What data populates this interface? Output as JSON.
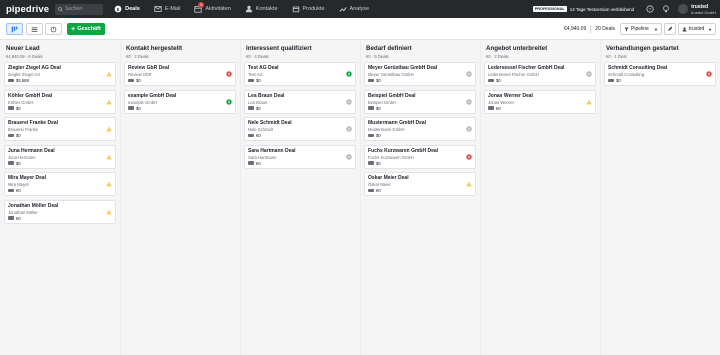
{
  "app": {
    "logo": "pipedrive",
    "search_placeholder": "Suchen"
  },
  "nav": [
    {
      "label": "Deals",
      "icon": "dollar-icon",
      "active": true
    },
    {
      "label": "E-Mail",
      "icon": "mail-icon"
    },
    {
      "label": "Aktivitäten",
      "icon": "calendar-icon",
      "badge": "5"
    },
    {
      "label": "Kontakte",
      "icon": "person-icon"
    },
    {
      "label": "Produkte",
      "icon": "box-icon"
    },
    {
      "label": "Analyse",
      "icon": "chart-icon"
    }
  ],
  "topright": {
    "plan": "PROFESSIONAL",
    "trial": "14 Tage Testversion verbleibend",
    "user": "trusted",
    "company": "trusted GmbH"
  },
  "toolbar": {
    "add_label": "Geschäft",
    "total": "€4,940.09",
    "deals_count": "20 Deals",
    "pipeline_label": "Pipeline",
    "owner_label": "trusted"
  },
  "colors": {
    "green": "#08a742",
    "warn": "#f6c344",
    "red": "#e0483f",
    "grey": "#b2b5ba"
  },
  "columns": [
    {
      "title": "Neuer Lead",
      "sub": "€4,940.09 · 6 Deals",
      "cards": [
        {
          "title": "Ziegler Ziegel AG Deal",
          "org": "Ziegler Ziegel AG",
          "value": "$5,588",
          "status": "warn"
        },
        {
          "title": "Köhler GmbH Deal",
          "org": "Köhler GmbH",
          "value": "$0",
          "status": "warn"
        },
        {
          "title": "Brauerei Franke Deal",
          "org": "Brauerei Franke",
          "value": "$0",
          "status": "warn"
        },
        {
          "title": "Juna Hermann Deal",
          "org": "Juna Hermann",
          "value": "$0",
          "status": "warn"
        },
        {
          "title": "Mira Mayer Deal",
          "org": "Mira Mayer",
          "value": "€0",
          "status": "warn"
        },
        {
          "title": "Jonathan Möller Deal",
          "org": "Jonathan Möller",
          "value": "€0",
          "status": "warn"
        }
      ]
    },
    {
      "title": "Kontakt hergestellt",
      "sub": "€0 · 2 Deals",
      "cards": [
        {
          "title": "Review GbR Deal",
          "org": "Review GbR",
          "value": "$0",
          "status": "red"
        },
        {
          "title": "example GmbH Deal",
          "org": "example GmbH",
          "value": "$0",
          "status": "green"
        }
      ]
    },
    {
      "title": "Interessent qualifiziert",
      "sub": "€0 · 4 Deals",
      "cards": [
        {
          "title": "Test AG Deal",
          "org": "Test AG",
          "value": "$0",
          "status": "green"
        },
        {
          "title": "Lea Braun Deal",
          "org": "Lea Braun",
          "value": "$0",
          "status": "grey"
        },
        {
          "title": "Nele Schmidt Deal",
          "org": "Nele Schmidt",
          "value": "€0",
          "status": "grey"
        },
        {
          "title": "Sara Hartmann Deal",
          "org": "Sara Hartmann",
          "value": "€0",
          "status": "grey"
        }
      ]
    },
    {
      "title": "Bedarf definiert",
      "sub": "€0 · 5 Deals",
      "cards": [
        {
          "title": "Meyer Gerüstbau GmbH Deal",
          "org": "Meyer Gerüstbau GmbH",
          "value": "$0",
          "status": "grey"
        },
        {
          "title": "Beispiel GmbH Deal",
          "org": "Beispiel GmbH",
          "value": "$0",
          "status": "grey"
        },
        {
          "title": "Mustermann GmbH Deal",
          "org": "Mustermann GmbH",
          "value": "$0",
          "status": "grey"
        },
        {
          "title": "Fuchs Kurzwaren GmbH Deal",
          "org": "Fuchs Kurzwaren GmbH",
          "value": "$0",
          "status": "red"
        },
        {
          "title": "Oskar Meier Deal",
          "org": "Oskar Meier",
          "value": "€0",
          "status": "warn"
        }
      ]
    },
    {
      "title": "Angebot unterbreitet",
      "sub": "€0 · 2 Deals",
      "cards": [
        {
          "title": "Ledersessel Fischer GmbH Deal",
          "org": "Ledersessel Fischer GmbH",
          "value": "$0",
          "status": "grey"
        },
        {
          "title": "Jonas Werner Deal",
          "org": "Jonas Werner",
          "value": "€0",
          "status": "warn"
        }
      ]
    },
    {
      "title": "Verhandlungen gestartet",
      "sub": "€0 · 1 Deal",
      "cards": [
        {
          "title": "Schmidt Consulting Deal",
          "org": "Schmidt Consulting",
          "value": "$0",
          "status": "red"
        }
      ]
    }
  ]
}
